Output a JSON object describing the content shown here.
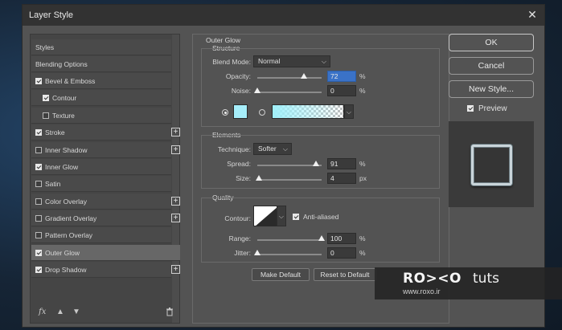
{
  "dialog": {
    "title": "Layer Style"
  },
  "sidebar": {
    "items": [
      {
        "label": "Styles",
        "checkbox": null,
        "plus": false,
        "indent": false,
        "selected": false
      },
      {
        "label": "Blending Options",
        "checkbox": null,
        "plus": false,
        "indent": false,
        "selected": false
      },
      {
        "label": "Bevel & Emboss",
        "checkbox": true,
        "plus": false,
        "indent": false,
        "selected": false
      },
      {
        "label": "Contour",
        "checkbox": true,
        "plus": false,
        "indent": true,
        "selected": false
      },
      {
        "label": "Texture",
        "checkbox": false,
        "plus": false,
        "indent": true,
        "selected": false
      },
      {
        "label": "Stroke",
        "checkbox": true,
        "plus": true,
        "indent": false,
        "selected": false
      },
      {
        "label": "Inner Shadow",
        "checkbox": false,
        "plus": true,
        "indent": false,
        "selected": false
      },
      {
        "label": "Inner Glow",
        "checkbox": true,
        "plus": false,
        "indent": false,
        "selected": false
      },
      {
        "label": "Satin",
        "checkbox": false,
        "plus": false,
        "indent": false,
        "selected": false
      },
      {
        "label": "Color Overlay",
        "checkbox": false,
        "plus": true,
        "indent": false,
        "selected": false
      },
      {
        "label": "Gradient Overlay",
        "checkbox": false,
        "plus": true,
        "indent": false,
        "selected": false
      },
      {
        "label": "Pattern Overlay",
        "checkbox": false,
        "plus": false,
        "indent": false,
        "selected": false
      },
      {
        "label": "Outer Glow",
        "checkbox": true,
        "plus": false,
        "indent": false,
        "selected": true
      },
      {
        "label": "Drop Shadow",
        "checkbox": true,
        "plus": true,
        "indent": false,
        "selected": false
      }
    ],
    "footer_icons": [
      "fx-icon",
      "move-up-icon",
      "move-down-icon",
      "trash-icon"
    ],
    "fx_label": "fx"
  },
  "outer_glow": {
    "section_title": "Outer Glow",
    "structure": {
      "title": "Structure",
      "blend_mode_label": "Blend Mode:",
      "blend_mode_value": "Normal",
      "opacity_label": "Opacity:",
      "opacity_value": "72",
      "noise_label": "Noise:",
      "noise_value": "0",
      "unit_percent": "%",
      "color_swatch": "#a6eefa"
    },
    "elements": {
      "title": "Elements",
      "technique_label": "Technique:",
      "technique_value": "Softer",
      "spread_label": "Spread:",
      "spread_value": "91",
      "size_label": "Size:",
      "size_value": "4",
      "unit_percent": "%",
      "unit_px": "px"
    },
    "quality": {
      "title": "Quality",
      "contour_label": "Contour:",
      "anti_aliased_label": "Anti-aliased",
      "range_label": "Range:",
      "range_value": "100",
      "jitter_label": "Jitter:",
      "jitter_value": "0",
      "unit_percent": "%"
    },
    "buttons": {
      "make_default": "Make Default",
      "reset_default": "Reset to Default"
    }
  },
  "actions": {
    "ok": "OK",
    "cancel": "Cancel",
    "new_style": "New Style...",
    "preview_label": "Preview"
  },
  "watermark": {
    "logo": "RO><O",
    "tuts": "tuts",
    "url": "www.roxo.ir"
  }
}
